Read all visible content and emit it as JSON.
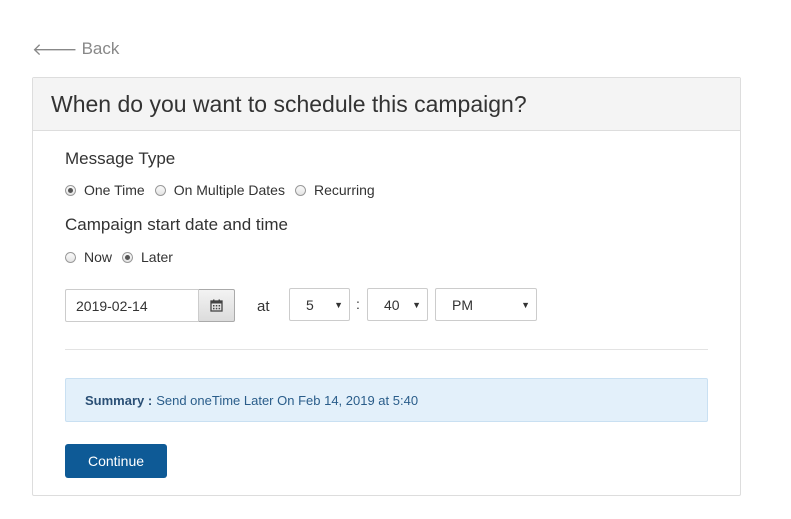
{
  "nav": {
    "back_label": "Back",
    "back_icon": "arrow-left-icon"
  },
  "panel": {
    "title": "When do you want to schedule this campaign?"
  },
  "message_type": {
    "label": "Message Type",
    "options": [
      {
        "label": "One Time",
        "checked": true
      },
      {
        "label": "On Multiple Dates",
        "checked": false
      },
      {
        "label": "Recurring",
        "checked": false
      }
    ]
  },
  "start": {
    "label": "Campaign start date and time",
    "options": [
      {
        "label": "Now",
        "checked": false
      },
      {
        "label": "Later",
        "checked": true
      }
    ],
    "date_value": "2019-02-14",
    "at_label": "at",
    "hour": "5",
    "separator": ":",
    "minute": "40",
    "ampm": "PM"
  },
  "summary": {
    "label": "Summary :",
    "text": "Send oneTime Later On Feb 14, 2019 at 5:40"
  },
  "actions": {
    "continue_label": "Continue"
  },
  "colors": {
    "primary": "#0e5a96",
    "summary_bg": "#e3f0fa",
    "summary_text": "#2a5d8a"
  }
}
